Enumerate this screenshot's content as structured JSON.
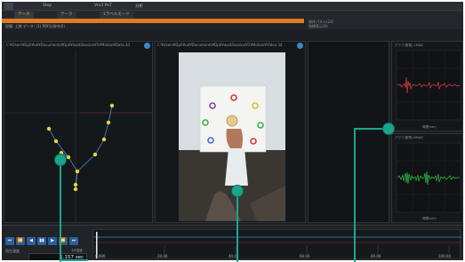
{
  "menubar": {
    "items": [
      "Step",
      "Vm3 PoT",
      "分析"
    ]
  },
  "tabs": [
    {
      "label": "データ",
      "active": true
    },
    {
      "label": "データ",
      "active": false
    },
    {
      "label": "1ラベルモード",
      "active": false
    }
  ],
  "status": {
    "text": "設備: 上肢  データ: (1)   PDF計測中(0)",
    "right_title": "操作パネル(24)",
    "right_sub": "指標表示(0)"
  },
  "panels": {
    "skeleton_path": "C:¥Users¥Dp0¥ud¥Documents¥Dp0¥walkSession¥1¥Motion¥Data.3d",
    "video_path": "C:¥Users¥Dp0¥ud¥Documents¥Dp0¥walkSession¥1¥Motion¥Video.3d"
  },
  "graphs": [
    {
      "title": "グラフ(筋電) 1MAD",
      "xlabel": "時間(sec)",
      "color": "#e03a3a"
    },
    {
      "title": "グラフ(筋電) 8MAD",
      "xlabel": "時間(sec)",
      "color": "#2fbf4a"
    }
  ],
  "timeline": {
    "transport": [
      "⏮",
      "⏪",
      "◀",
      "▮▮",
      "▶",
      "⏩",
      "⏭"
    ],
    "mode_label": "再生速度",
    "fps_label": "1/1倍速",
    "time_value": "1.157 sec",
    "tick_labels": [
      "0.000",
      "20.00",
      "40.00",
      "60.00",
      "80.00",
      "100.00"
    ]
  },
  "colors": {
    "accent": "#e07b23",
    "callout": "#1aa88f",
    "marker": "#e3d839",
    "bone": "#4a88c8"
  }
}
